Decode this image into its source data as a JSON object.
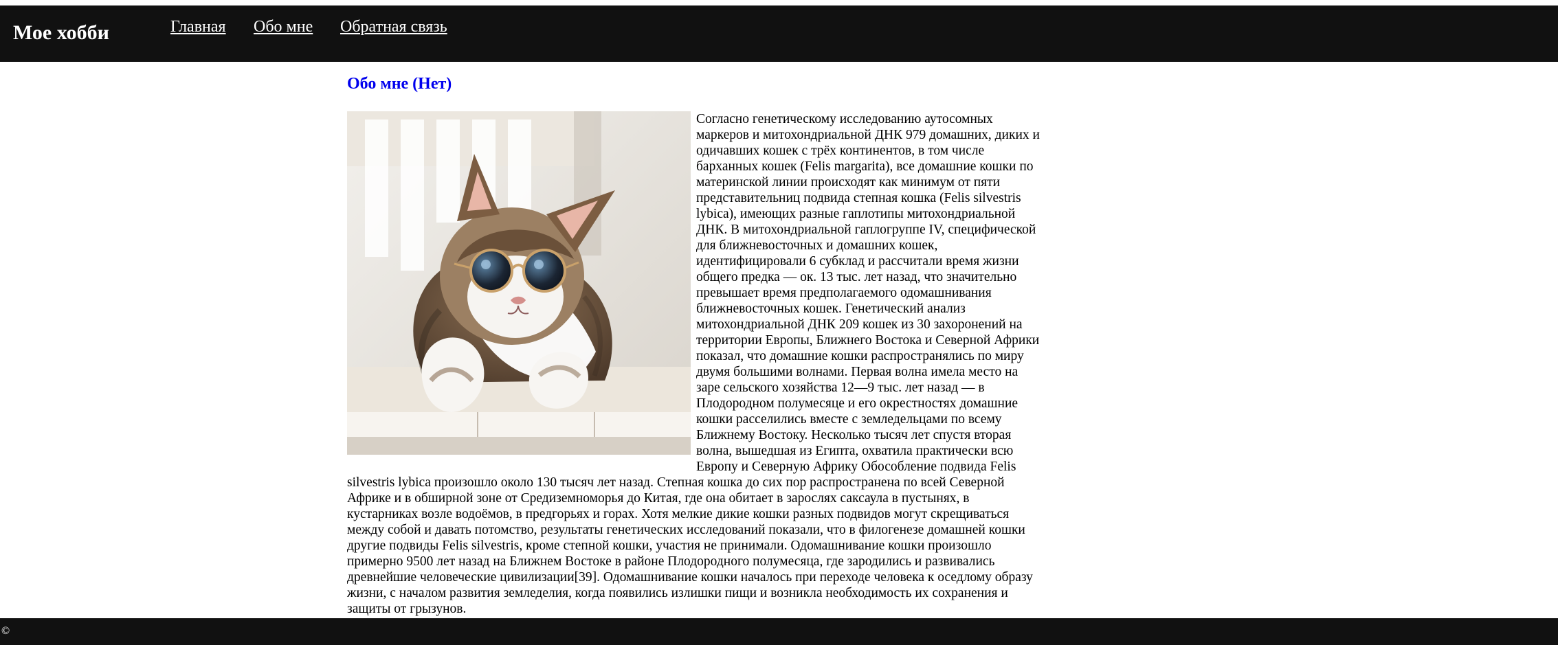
{
  "header": {
    "logo": "Мое хобби",
    "nav": [
      {
        "label": "Главная"
      },
      {
        "label": "Обо мне"
      },
      {
        "label": "Обратная связь"
      }
    ]
  },
  "main": {
    "title": "Обо мне (Нет)",
    "image": {
      "subject": "cat wearing round sunglasses"
    },
    "article_text": "Согласно генетическому исследованию аутосомных маркеров и митохондриальной ДНК 979 домашних, диких и одичавших кошек с трёх континентов, в том числе барханных кошек (Felis margarita), все домашние кошки по материнской линии происходят как минимум от пяти представительниц подвида степная кошка (Felis silvestris lybica), имеющих разные гаплотипы митохондриальной ДНК. В митохондриальной гаплогруппе IV, специфической для ближневосточных и домашних кошек, идентифицировали 6 субклад и рассчитали время жизни общего предка — ок. 13 тыс. лет назад, что значительно превышает время предполагаемого одомашнивания ближневосточных кошек. Генетический анализ митохондриальной ДНК 209 кошек из 30 захоронений на территории Европы, Ближнего Востока и Северной Африки показал, что домашние кошки распространялись по миру двумя большими волнами. Первая волна имела место на заре сельского хозяйства 12—9 тыс. лет назад — в Плодородном полумесяце и его окрестностях домашние кошки расселились вместе с земледельцами по всему Ближнему Востоку. Несколько тысяч лет спустя вторая волна, вышедшая из Египта, охватила практически всю Европу и Северную Африку Обособление подвида Felis silvestris lybica произошло около 130 тысяч лет назад. Степная кошка до сих пор распространена по всей Северной Африке и в обширной зоне от Средиземноморья до Китая, где она обитает в зарослях саксаула в пустынях, в кустарниках возле водоёмов, в предгорьях и горах. Хотя мелкие дикие кошки разных подвидов могут скрещиваться между собой и давать потомство, результаты генетических исследований показали, что в филогенезе домашней кошки другие подвиды Felis silvestris, кроме степной кошки, участия не принимали. Одомашнивание кошки произошло примерно 9500 лет назад на Ближнем Востоке в районе Плодородного полумесяца, где зародились и развивались древнейшие человеческие цивилизации[39]. Одомашнивание кошки началось при переходе человека к оседлому образу жизни, с началом развития земледелия, когда появились излишки пищи и возникла необходимость их сохранения и защиты от грызунов."
  },
  "footer": {
    "copyright": "©"
  },
  "colors": {
    "header_bg": "#111111",
    "footer_bg": "#111111",
    "title_color": "#0000ee",
    "text_color": "#000000"
  }
}
